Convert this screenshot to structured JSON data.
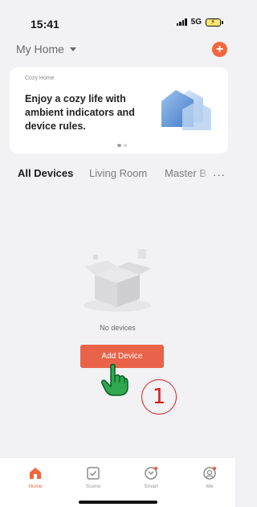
{
  "status_bar": {
    "time": "15:41",
    "network": "5G"
  },
  "header": {
    "home_selector": "My Home",
    "add_icon": "plus-icon"
  },
  "banner": {
    "tag": "Cozy Home",
    "text": "Enjoy a cozy life with ambient indicators and device rules.",
    "slide_count": 2,
    "active_slide": 1
  },
  "tabs": {
    "items": [
      "All Devices",
      "Living Room",
      "Master B"
    ],
    "active": "All Devices",
    "more_label": "···"
  },
  "empty_state": {
    "message": "No devices",
    "button_label": "Add Device"
  },
  "annotation": {
    "step_number": "1"
  },
  "bottom_nav": {
    "items": [
      {
        "label": "Home",
        "icon": "home-icon",
        "active": true
      },
      {
        "label": "Scene",
        "icon": "checkbox-icon",
        "active": false
      },
      {
        "label": "Smart",
        "icon": "smart-icon",
        "active": false
      },
      {
        "label": "Me",
        "icon": "profile-icon",
        "active": false
      }
    ]
  },
  "colors": {
    "accent": "#f2673d",
    "button": "#e9634a",
    "annotation_red": "#d91c1c",
    "pointer_green": "#2fa84f",
    "background": "#f2f2f5"
  }
}
